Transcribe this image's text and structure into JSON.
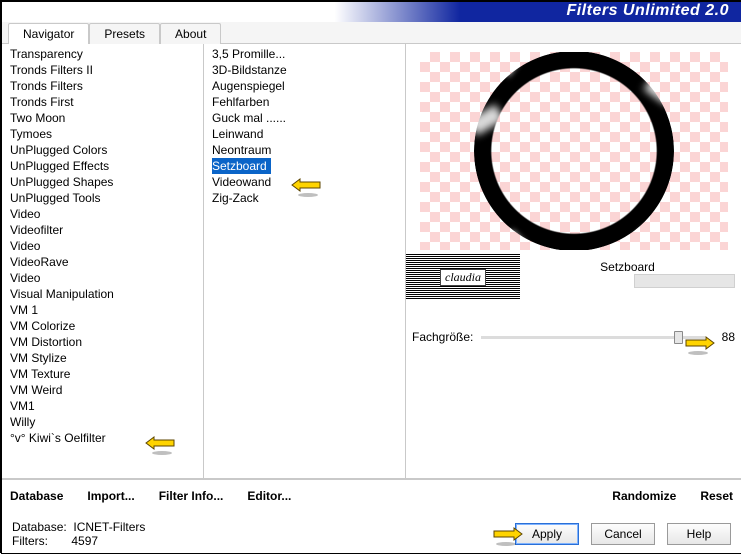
{
  "app": {
    "title": "Filters Unlimited 2.0"
  },
  "tabs": [
    "Navigator",
    "Presets",
    "About"
  ],
  "categories": [
    "Transparency",
    "Tronds Filters II",
    "Tronds Filters",
    "Tronds First",
    "Two Moon",
    "Tymoes",
    "UnPlugged Colors",
    "UnPlugged Effects",
    "UnPlugged Shapes",
    "UnPlugged Tools",
    "Video",
    "Videofilter",
    "Video",
    "VideoRave",
    "Video",
    "Visual Manipulation",
    "VM 1",
    "VM Colorize",
    "VM Distortion",
    "VM Stylize",
    "VM Texture",
    "VM Weird",
    "VM1",
    "Willy",
    "°v° Kiwi`s Oelfilter"
  ],
  "filters": [
    "3,5 Promille...",
    "3D-Bildstanze",
    "Augenspiegel",
    "Fehlfarben",
    "Guck mal ......",
    "Leinwand",
    "Neontraum",
    "Setzboard",
    "Videowand",
    "Zig-Zack"
  ],
  "selected_filter_index": 7,
  "toolbar": {
    "database": "Database",
    "import": "Import...",
    "filterinfo": "Filter Info...",
    "editor": "Editor...",
    "randomize": "Randomize",
    "reset": "Reset"
  },
  "preview": {
    "filter_name": "Setzboard"
  },
  "stamp": {
    "text": "claudia"
  },
  "params": [
    {
      "label": "Fachgröße:",
      "value": 88
    }
  ],
  "footer": {
    "db_label": "Database:",
    "db_value": "ICNET-Filters",
    "filters_label": "Filters:",
    "filters_count": "4597",
    "apply": "Apply",
    "cancel": "Cancel",
    "help": "Help"
  }
}
